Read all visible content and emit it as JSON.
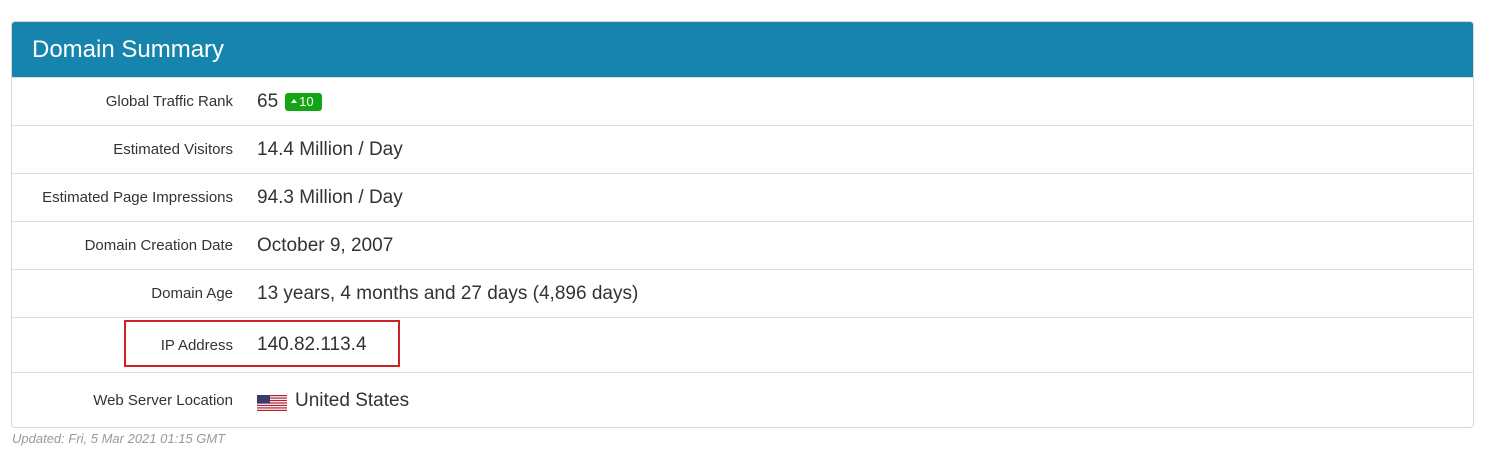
{
  "panel": {
    "title": "Domain Summary"
  },
  "rows": [
    {
      "label": "Global Traffic Rank",
      "value": "65",
      "badge": {
        "text": "10",
        "direction": "up",
        "color": "#14a514"
      }
    },
    {
      "label": "Estimated Visitors",
      "value": "14.4 Million / Day"
    },
    {
      "label": "Estimated Page Impressions",
      "value": "94.3 Million / Day"
    },
    {
      "label": "Domain Creation Date",
      "value": "October 9, 2007"
    },
    {
      "label": "Domain Age",
      "value": "13 years, 4 months and 27 days (4,896 days)"
    },
    {
      "label": "IP Address",
      "value": "140.82.113.4",
      "highlighted": true
    },
    {
      "label": "Web Server Location",
      "value": "United States",
      "icon": "us-flag-icon"
    }
  ],
  "footer": {
    "updated": "Updated: Fri, 5 Mar 2021 01:15 GMT"
  },
  "colors": {
    "header": "#1784ae",
    "highlight": "#d0202a",
    "badge": "#14a514"
  }
}
